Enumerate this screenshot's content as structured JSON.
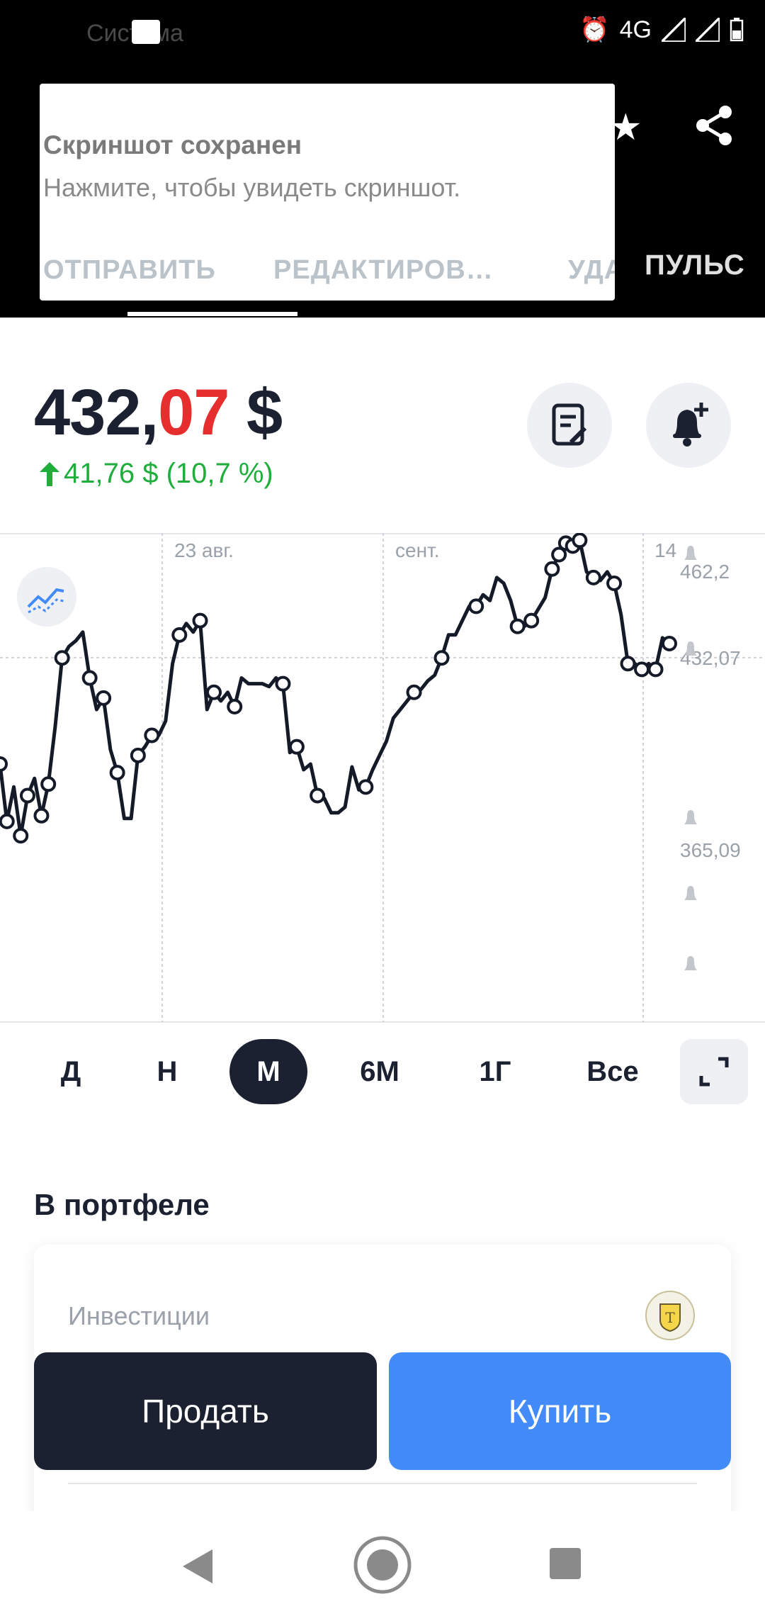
{
  "status_bar": {
    "app_label": "Система",
    "network": "4G"
  },
  "header": {
    "tab_label": "ПУЛЬС"
  },
  "notification": {
    "title": "Скриншот сохранен",
    "text": "Нажмите, чтобы увидеть скриншот.",
    "actions": [
      "ОТПРАВИТЬ",
      "РЕДАКТИРОВ…",
      "УДА"
    ]
  },
  "price": {
    "integer": "432,",
    "decimals": "07",
    "currency": " $",
    "change": "41,76 $ (10,7 %)",
    "change_color": "#1fae3c",
    "decimals_color": "#e62e2e"
  },
  "chart_data": {
    "type": "line",
    "x_labels": [
      "23 авг.",
      "сент.",
      "14"
    ],
    "y_labels": [
      "462,2",
      "432,07",
      "365,09"
    ],
    "current_value": 432.07,
    "y_range": [
      365.09,
      462.2
    ],
    "series": [
      {
        "values": [
          395,
          375,
          387,
          370,
          384,
          390,
          377,
          388,
          408,
          432,
          436,
          438,
          441,
          425,
          414,
          418,
          400,
          392,
          376,
          376,
          398,
          401,
          405,
          405,
          410,
          430,
          440,
          444,
          441,
          445,
          414,
          420,
          417,
          420,
          415,
          425,
          423,
          423,
          423,
          422,
          425,
          423,
          399,
          401,
          393,
          395,
          384,
          383,
          378,
          378,
          380,
          394,
          386,
          387,
          393,
          398,
          403,
          411,
          414,
          417,
          420,
          421,
          424,
          426,
          432,
          440,
          440,
          445,
          450,
          450,
          454,
          452,
          460,
          458,
          452,
          443,
          443,
          445,
          449,
          453,
          463,
          468,
          472,
          471,
          473,
          462,
          460,
          459,
          462,
          458,
          447,
          430,
          430,
          428,
          430,
          428,
          439,
          437
        ]
      }
    ],
    "grid": true
  },
  "periods": [
    "Д",
    "Н",
    "М",
    "6М",
    "1Г",
    "Все"
  ],
  "selected_period": "М",
  "portfolio": {
    "title": "В портфеле",
    "label": "Инвестиции"
  },
  "actions": {
    "sell": "Продать",
    "buy": "Купить"
  }
}
